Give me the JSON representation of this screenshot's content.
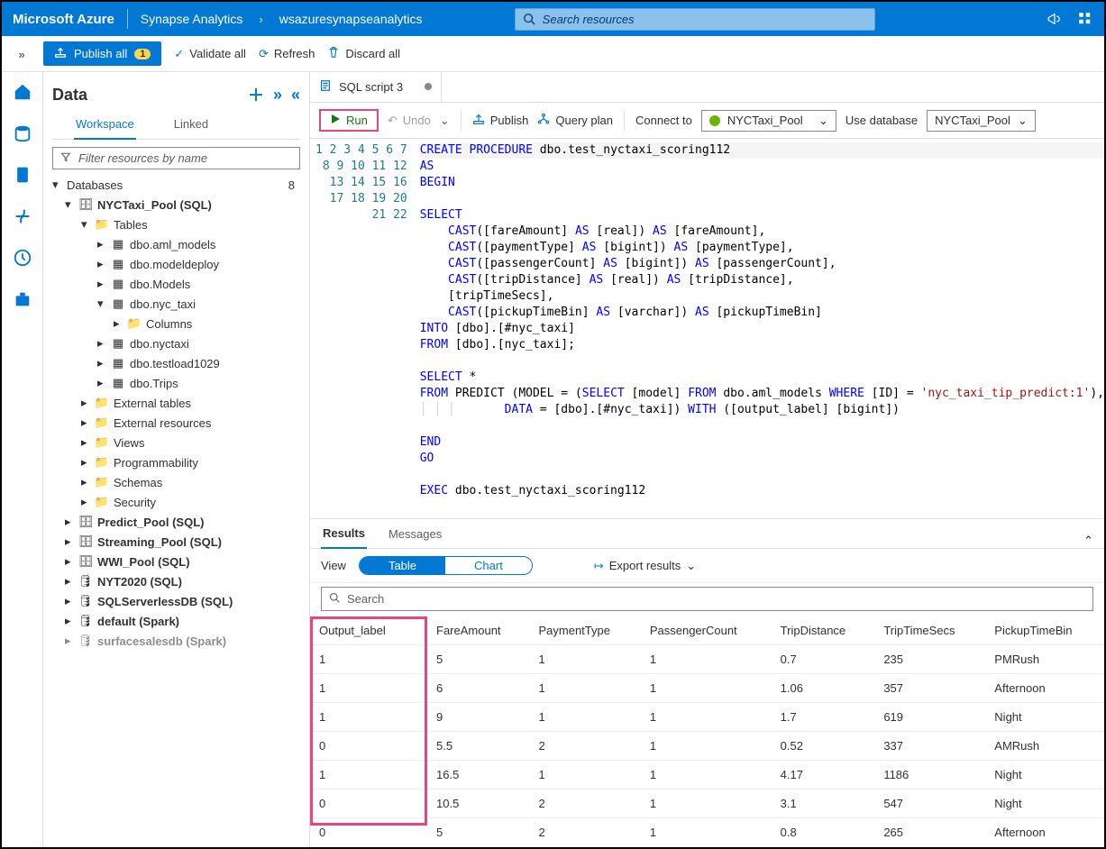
{
  "header": {
    "brand": "Microsoft Azure",
    "crumb1": "Synapse Analytics",
    "crumb2": "wsazuresynapseanalytics",
    "search_placeholder": "Search resources"
  },
  "toolbar2": {
    "publish_all": "Publish all",
    "publish_badge": "1",
    "validate": "Validate all",
    "refresh": "Refresh",
    "discard": "Discard all"
  },
  "datapanel": {
    "title": "Data",
    "tab_workspace": "Workspace",
    "tab_linked": "Linked",
    "filter_placeholder": "Filter resources by name",
    "databases_label": "Databases",
    "databases_count": "8",
    "pool_label": "NYCTaxi_Pool (SQL)",
    "tables_label": "Tables",
    "tables": {
      "t0": "dbo.aml_models",
      "t1": "dbo.modeldeploy",
      "t2": "dbo.Models",
      "t3": "dbo.nyc_taxi",
      "t3c": "Columns",
      "t4": "dbo.nyctaxi",
      "t5": "dbo.testload1029",
      "t6": "dbo.Trips"
    },
    "ext_tables": "External tables",
    "ext_res": "External resources",
    "views": "Views",
    "prog": "Programmability",
    "schemas": "Schemas",
    "security": "Security",
    "pools": {
      "p1": "Predict_Pool (SQL)",
      "p2": "Streaming_Pool (SQL)",
      "p3": "WWI_Pool (SQL)",
      "p4": "NYT2020 (SQL)",
      "p5": "SQLServerlessDB (SQL)",
      "p6": "default (Spark)",
      "p7": "surfacesalesdb (Spark)"
    }
  },
  "filetab": {
    "name": "SQL script 3"
  },
  "editor_toolbar": {
    "run": "Run",
    "undo": "Undo",
    "publish": "Publish",
    "queryplan": "Query plan",
    "connect": "Connect to",
    "connect_val": "NYCTaxi_Pool",
    "usedb": "Use database",
    "usedb_val": "NYCTaxi_Pool"
  },
  "code": {
    "l1a": "CREATE",
    "l1b": "PROCEDURE",
    "l1c": " dbo.test_nyctaxi_scoring112",
    "l2": "AS",
    "l3": "BEGIN",
    "l5": "SELECT",
    "l6a": "CAST",
    "l6b": "([fareAmount] ",
    "l6c": "AS",
    "l6d": " [real]) ",
    "l6e": "AS",
    "l6f": " [fareAmount],",
    "l7b": "([paymentType] ",
    "l7d": " [bigint]) ",
    "l7f": " [paymentType],",
    "l8b": "([passengerCount] ",
    "l8d": " [bigint]) ",
    "l8f": " [passengerCount],",
    "l9b": "([tripDistance] ",
    "l9d": " [real]) ",
    "l9f": " [tripDistance],",
    "l10": "[tripTimeSecs],",
    "l11b": "([pickupTimeBin] ",
    "l11d": " [varchar]) ",
    "l11f": " [pickupTimeBin]",
    "l12a": "INTO",
    "l12b": " [dbo].[#nyc_taxi]",
    "l13a": "FROM",
    "l13b": " [dbo].[nyc_taxi];",
    "l15a": "SELECT",
    "l15b": " *",
    "l16a": "FROM",
    "l16b": " PREDICT (MODEL = (",
    "l16c": "SELECT",
    "l16d": " [model] ",
    "l16e": "FROM",
    "l16f": " dbo.aml_models ",
    "l16g": "WHERE",
    "l16h": " [ID] = ",
    "l16i": "'nyc_taxi_tip_predict:1'",
    "l16j": "),",
    "l17a": "DATA",
    "l17b": " = [dbo].[#nyc_taxi]) ",
    "l17c": "WITH",
    "l17d": " ([output_label] [bigint])",
    "l19": "END",
    "l20": "GO",
    "l22a": "EXEC",
    "l22b": " dbo.test_nyctaxi_scoring112"
  },
  "results": {
    "tab_results": "Results",
    "tab_messages": "Messages",
    "view_label": "View",
    "seg_table": "Table",
    "seg_chart": "Chart",
    "export": "Export results",
    "search_placeholder": "Search",
    "headers": {
      "h0": "Output_label",
      "h1": "FareAmount",
      "h2": "PaymentType",
      "h3": "PassengerCount",
      "h4": "TripDistance",
      "h5": "TripTimeSecs",
      "h6": "PickupTimeBin"
    },
    "rows": {
      "r0": {
        "c0": "1",
        "c1": "5",
        "c2": "1",
        "c3": "1",
        "c4": "0.7",
        "c5": "235",
        "c6": "PMRush"
      },
      "r1": {
        "c0": "1",
        "c1": "6",
        "c2": "1",
        "c3": "1",
        "c4": "1.06",
        "c5": "357",
        "c6": "Afternoon"
      },
      "r2": {
        "c0": "1",
        "c1": "9",
        "c2": "1",
        "c3": "1",
        "c4": "1.7",
        "c5": "619",
        "c6": "Night"
      },
      "r3": {
        "c0": "0",
        "c1": "5.5",
        "c2": "2",
        "c3": "1",
        "c4": "0.52",
        "c5": "337",
        "c6": "AMRush"
      },
      "r4": {
        "c0": "1",
        "c1": "16.5",
        "c2": "1",
        "c3": "1",
        "c4": "4.17",
        "c5": "1186",
        "c6": "Night"
      },
      "r5": {
        "c0": "0",
        "c1": "10.5",
        "c2": "2",
        "c3": "1",
        "c4": "3.1",
        "c5": "547",
        "c6": "Night"
      },
      "r6": {
        "c0": "0",
        "c1": "5",
        "c2": "2",
        "c3": "1",
        "c4": "0.8",
        "c5": "265",
        "c6": "Afternoon"
      }
    }
  }
}
